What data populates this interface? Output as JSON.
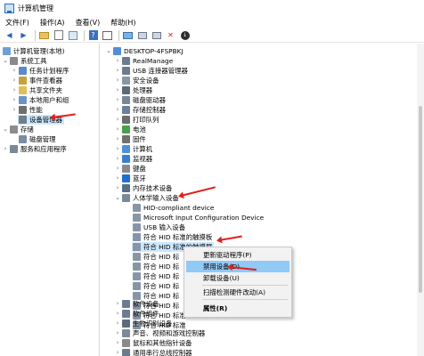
{
  "window": {
    "title": "计算机管理"
  },
  "menu": [
    "文件(F)",
    "操作(A)",
    "查看(V)",
    "帮助(H)"
  ],
  "toolbar_icons": [
    "back-arrow-icon",
    "forward-arrow-icon",
    "folder-up-icon",
    "properties-icon",
    "refresh-icon",
    "help-icon",
    "show-hide-tree-icon",
    "computer-icon",
    "uninstall-device-icon",
    "update-driver-icon",
    "delete-icon",
    "download-icon"
  ],
  "left_tree": [
    {
      "label": "计算机管理(本地)",
      "icon": "computer-management-icon"
    },
    {
      "label": "系统工具",
      "icon": "tools-icon"
    },
    {
      "label": "任务计划程序",
      "icon": "task-scheduler-icon"
    },
    {
      "label": "事件查看器",
      "icon": "event-viewer-icon"
    },
    {
      "label": "共享文件夹",
      "icon": "shared-folder-icon"
    },
    {
      "label": "本地用户和组",
      "icon": "users-icon"
    },
    {
      "label": "性能",
      "icon": "performance-icon"
    },
    {
      "label": "设备管理器",
      "icon": "device-manager-icon"
    },
    {
      "label": "存储",
      "icon": "storage-icon"
    },
    {
      "label": "磁盘管理",
      "icon": "disk-icon"
    },
    {
      "label": "服务和应用程序",
      "icon": "services-icon"
    }
  ],
  "device_tree": [
    {
      "label": "DESKTOP-4FSPBKJ",
      "icon": "computer-icon"
    },
    {
      "label": "RealManage",
      "icon": "device-icon"
    },
    {
      "label": "USB 连接器管理器",
      "icon": "usb-icon"
    },
    {
      "label": "安全设备",
      "icon": "security-device-icon"
    },
    {
      "label": "处理器",
      "icon": "processor-icon"
    },
    {
      "label": "磁盘驱动器",
      "icon": "disk-drive-icon"
    },
    {
      "label": "存储控制器",
      "icon": "storage-controller-icon"
    },
    {
      "label": "打印队列",
      "icon": "printer-icon"
    },
    {
      "label": "电池",
      "icon": "battery-icon"
    },
    {
      "label": "固件",
      "icon": "firmware-icon"
    },
    {
      "label": "计算机",
      "icon": "computer-icon"
    },
    {
      "label": "监视器",
      "icon": "monitor-icon"
    },
    {
      "label": "键盘",
      "icon": "keyboard-icon"
    },
    {
      "label": "蓝牙",
      "icon": "bluetooth-icon"
    },
    {
      "label": "内存技术设备",
      "icon": "memory-icon"
    },
    {
      "label": "人体学输入设备",
      "icon": "hid-icon"
    },
    {
      "label": "HID-compliant device",
      "icon": "hid-device-icon"
    },
    {
      "label": "Microsoft Input Configuration Device",
      "icon": "hid-device-icon"
    },
    {
      "label": "USB 输入设备",
      "icon": "hid-device-icon"
    },
    {
      "label": "符合 HID 标准的触摸板",
      "icon": "hid-device-icon"
    },
    {
      "label": "符合 HID 标准的触摸屏",
      "icon": "hid-device-icon"
    },
    {
      "label": "符合 HID 标",
      "icon": "hid-device-icon"
    },
    {
      "label": "符合 HID 标",
      "icon": "hid-device-icon"
    },
    {
      "label": "符合 HID 标",
      "icon": "hid-device-icon"
    },
    {
      "label": "符合 HID 标",
      "icon": "hid-device-icon"
    },
    {
      "label": "符合 HID 标",
      "icon": "hid-device-icon"
    },
    {
      "label": "符合 HID 标",
      "icon": "hid-device-icon"
    },
    {
      "label": "符合 HID 标准",
      "icon": "hid-device-icon"
    },
    {
      "label": "符合 HID 标准",
      "icon": "hid-device-icon"
    },
    {
      "label": "软件设备",
      "icon": "software-device-icon"
    },
    {
      "label": "软件组件",
      "icon": "software-component-icon"
    },
    {
      "label": "生物识别设备",
      "icon": "biometric-icon"
    },
    {
      "label": "声音、视频和游戏控制器",
      "icon": "audio-icon"
    },
    {
      "label": "鼠标和其他指针设备",
      "icon": "mouse-icon"
    },
    {
      "label": "通用串行总线控制器",
      "icon": "usb-controller-icon"
    }
  ],
  "context_menu": [
    "更新驱动程序(P)",
    "禁用设备(D)",
    "卸载设备(U)",
    "扫描检测硬件改动(A)",
    "属性(R)"
  ],
  "colors": {
    "selection": "#cde8ff",
    "menu_hover": "#91c9f7",
    "annotation_arrow": "#e0201a"
  }
}
